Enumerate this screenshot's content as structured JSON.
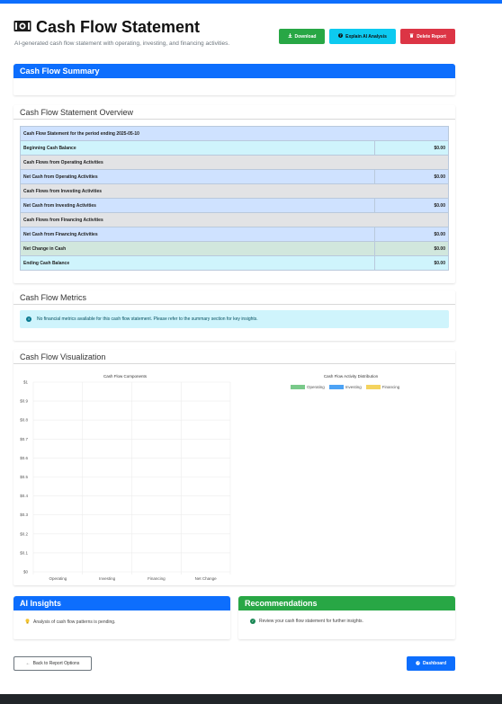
{
  "header": {
    "title": "Cash Flow Statement",
    "subtitle": "AI-generated cash flow statement with operating, investing, and financing activities.",
    "title_icon": "money-bill-icon",
    "buttons": {
      "download": "Download",
      "explain": "Explain AI Analysis",
      "delete": "Delete Report"
    }
  },
  "summary": {
    "title": "Cash Flow Summary"
  },
  "overview": {
    "title": "Cash Flow Statement Overview",
    "rows": [
      {
        "label": "Cash Flow Statement for the period ending 2025-05-10",
        "value": "",
        "style": "blue",
        "span": true
      },
      {
        "label": "Beginning Cash Balance",
        "value": "$0.00",
        "style": "cyan"
      },
      {
        "label": "Cash Flows from Operating Activities",
        "value": "",
        "style": "gray",
        "span": true
      },
      {
        "label": "Net Cash from Operating Activities",
        "value": "$0.00",
        "style": "blue"
      },
      {
        "label": "Cash Flows from Investing Activities",
        "value": "",
        "style": "gray",
        "span": true
      },
      {
        "label": "Net Cash from Investing Activities",
        "value": "$0.00",
        "style": "blue"
      },
      {
        "label": "Cash Flows from Financing Activities",
        "value": "",
        "style": "gray",
        "span": true
      },
      {
        "label": "Net Cash from Financing Activities",
        "value": "$0.00",
        "style": "blue"
      },
      {
        "label": "Net Change in Cash",
        "value": "$0.00",
        "style": "green"
      },
      {
        "label": "Ending Cash Balance",
        "value": "$0.00",
        "style": "cyan"
      }
    ]
  },
  "metrics": {
    "title": "Cash Flow Metrics",
    "alert": "No financial metrics available for this cash flow statement. Please refer to the summary section for key insights."
  },
  "visualization": {
    "title": "Cash Flow Visualization"
  },
  "chart_data": [
    {
      "type": "bar",
      "title": "Cash Flow Components",
      "categories": [
        "Operating",
        "Investing",
        "Financing",
        "Net Change"
      ],
      "values": [
        0,
        0,
        0,
        0
      ],
      "ylim": [
        0,
        1
      ],
      "yticks": [
        "$0",
        "$0.1",
        "$0.2",
        "$0.3",
        "$0.4",
        "$0.5",
        "$0.6",
        "$0.7",
        "$0.8",
        "$0.9",
        "$1"
      ],
      "grid": true
    },
    {
      "type": "pie",
      "title": "Cash Flow Activity Distribution",
      "categories": [
        "Operating",
        "Investing",
        "Financing"
      ],
      "values": [
        0,
        0,
        0
      ],
      "colors": [
        "#7ac98a",
        "#4da3f5",
        "#f4d35e"
      ],
      "legend": "top"
    }
  ],
  "insights": {
    "title": "AI Insights",
    "text": "Analysis of cash flow patterns is pending."
  },
  "recommendations": {
    "title": "Recommendations",
    "text": "Review your cash flow statement for further insights."
  },
  "nav": {
    "back": "Back to Report Options",
    "dashboard": "Dashboard"
  },
  "colors": {
    "primary": "#0d6efd",
    "success": "#28a745",
    "info": "#0dcaf0",
    "danger": "#dc3545"
  }
}
